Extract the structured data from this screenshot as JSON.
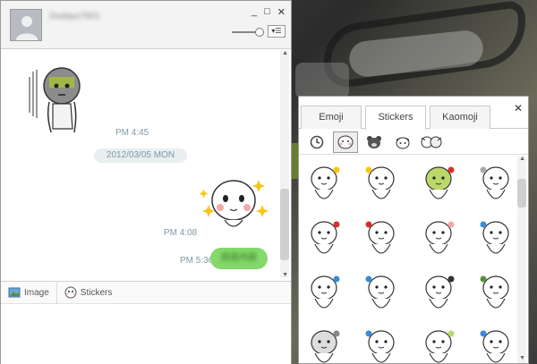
{
  "chat": {
    "username": "Dodayo7601",
    "window_buttons": {
      "minimize": "_",
      "maximize": "□",
      "close": "✕"
    },
    "menu_icon": "menu-icon",
    "messages": [
      {
        "type": "sticker",
        "side": "left",
        "sticker": "sad-stickman-sticker"
      },
      {
        "type": "timestamp",
        "text": "PM 4:45"
      },
      {
        "type": "date",
        "text": "2012/03/05 MON"
      },
      {
        "type": "sticker",
        "side": "right",
        "sticker": "blushing-stickman-sticker"
      },
      {
        "type": "timestamp",
        "text": "PM 4:08"
      },
      {
        "type": "timestamp",
        "text": "PM 5:36"
      },
      {
        "type": "bubble",
        "side": "right",
        "text": "訊息內容"
      }
    ],
    "toolbar": {
      "image_label": "Image",
      "stickers_label": "Stickers"
    }
  },
  "sticker_panel": {
    "tabs": [
      "Emoji",
      "Stickers",
      "Kaomoji"
    ],
    "active_tab": "Stickers",
    "close": "✕",
    "categories": [
      "clock-icon",
      "stickman-icon",
      "bear-icon",
      "girl-icon",
      "pair-icon"
    ],
    "active_category": "stickman-icon",
    "sticker_count": 16
  },
  "colors": {
    "bubble": "#84d96a",
    "timestamp": "#7f9aa6"
  }
}
